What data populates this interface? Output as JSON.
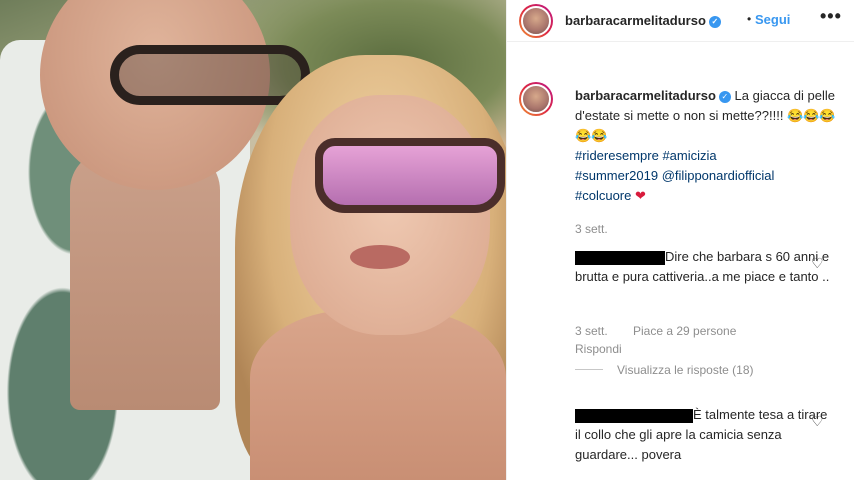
{
  "post": {
    "username": "barbaracarmelitadurso",
    "follow_label": "Segui",
    "more_label": "•••",
    "dot": "•"
  },
  "caption": {
    "username": "barbaracarmelitadurso",
    "text": "La giacca di pelle d'estate si mette o non si mette??!!!!",
    "emojis": "😂😂😂😂😂",
    "hashtags": [
      "#rideresempre",
      "#amicizia",
      "#summer2019",
      "@filipponardiofficial",
      "#colcuore"
    ],
    "heart": "❤",
    "time": "3 sett."
  },
  "comments": [
    {
      "text_line1": "Dire che barbara s",
      "text_rest": "60 anni e brutta e pura cattiveria..a me piace e tanto ..",
      "time": "3 sett.",
      "likes": "Piace a 29 persone",
      "reply_label": "Rispondi",
      "view_replies": "Visualizza le risposte (18)"
    },
    {
      "text_line1": "È talmente tesa",
      "text_rest": "a tirare il collo che gli apre la camicia senza guardare... povera"
    }
  ],
  "colors": {
    "link_blue": "#3897f0",
    "hashtag_blue": "#00376b",
    "muted": "#8e8e8e",
    "heart_red": "#d81b3c"
  },
  "icons": {
    "like": "heart-outline-icon",
    "verified": "verified-badge-icon",
    "more": "more-options-icon"
  }
}
